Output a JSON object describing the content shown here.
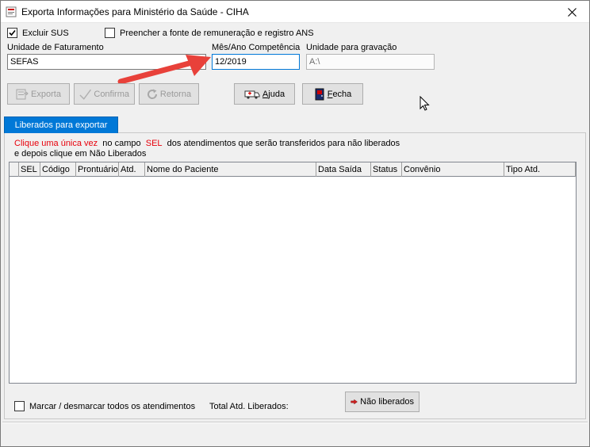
{
  "window": {
    "title": "Exporta Informações para Ministério da Saúde - CIHA"
  },
  "options": {
    "excluir_sus": {
      "label": "Excluir SUS",
      "checked": true
    },
    "preencher_fonte": {
      "label": "Preencher a fonte de remuneração e registro ANS",
      "checked": false
    }
  },
  "fields": {
    "unidade_faturamento": {
      "label": "Unidade de Faturamento",
      "value": "SEFAS"
    },
    "mes_ano": {
      "label": "Mês/Ano Competência",
      "value": "12/2019"
    },
    "unidade_gravacao": {
      "label": "Unidade para gravação",
      "value": "A:\\"
    }
  },
  "toolbar": {
    "exporta": "Exporta",
    "confirma": "Confirma",
    "retorna": "Retorna",
    "ajuda_underlined": "A",
    "ajuda_rest": "juda",
    "fecha_underlined": "F",
    "fecha_rest": "echa"
  },
  "tabs": {
    "liberados": "Liberados para exportar"
  },
  "instructions": {
    "part1": "Clique uma única vez",
    "part2": "no campo",
    "part3": "SEL",
    "part4": "dos atendimentos que serão transferidos para não liberados",
    "line2": "e depois clique em Não Liberados"
  },
  "grid": {
    "columns": [
      "SEL",
      "Código",
      "Prontuário",
      "Atd.",
      "Nome do Paciente",
      "Data Saída",
      "Status",
      "Convênio",
      "Tipo Atd."
    ]
  },
  "footer": {
    "marcar_label": "Marcar / desmarcar todos os atendimentos",
    "total_label": "Total Atd. Liberados:",
    "nao_liberados": "Não liberados"
  }
}
